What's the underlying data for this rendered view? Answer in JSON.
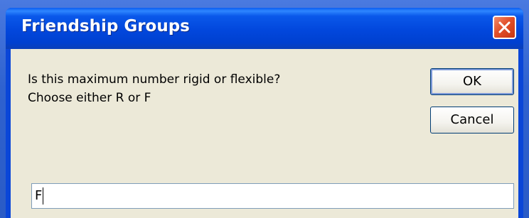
{
  "window": {
    "title": "Friendship Groups"
  },
  "message": {
    "line1": "Is this maximum number rigid or flexible?",
    "line2": "Choose either R or F"
  },
  "buttons": {
    "ok_label": "OK",
    "cancel_label": "Cancel"
  },
  "input": {
    "value": "F"
  },
  "colors": {
    "titlebar": "#0a46d8",
    "client_bg": "#ece9d8",
    "close_button": "#e2502a"
  },
  "icons": {
    "close": "close-icon"
  }
}
